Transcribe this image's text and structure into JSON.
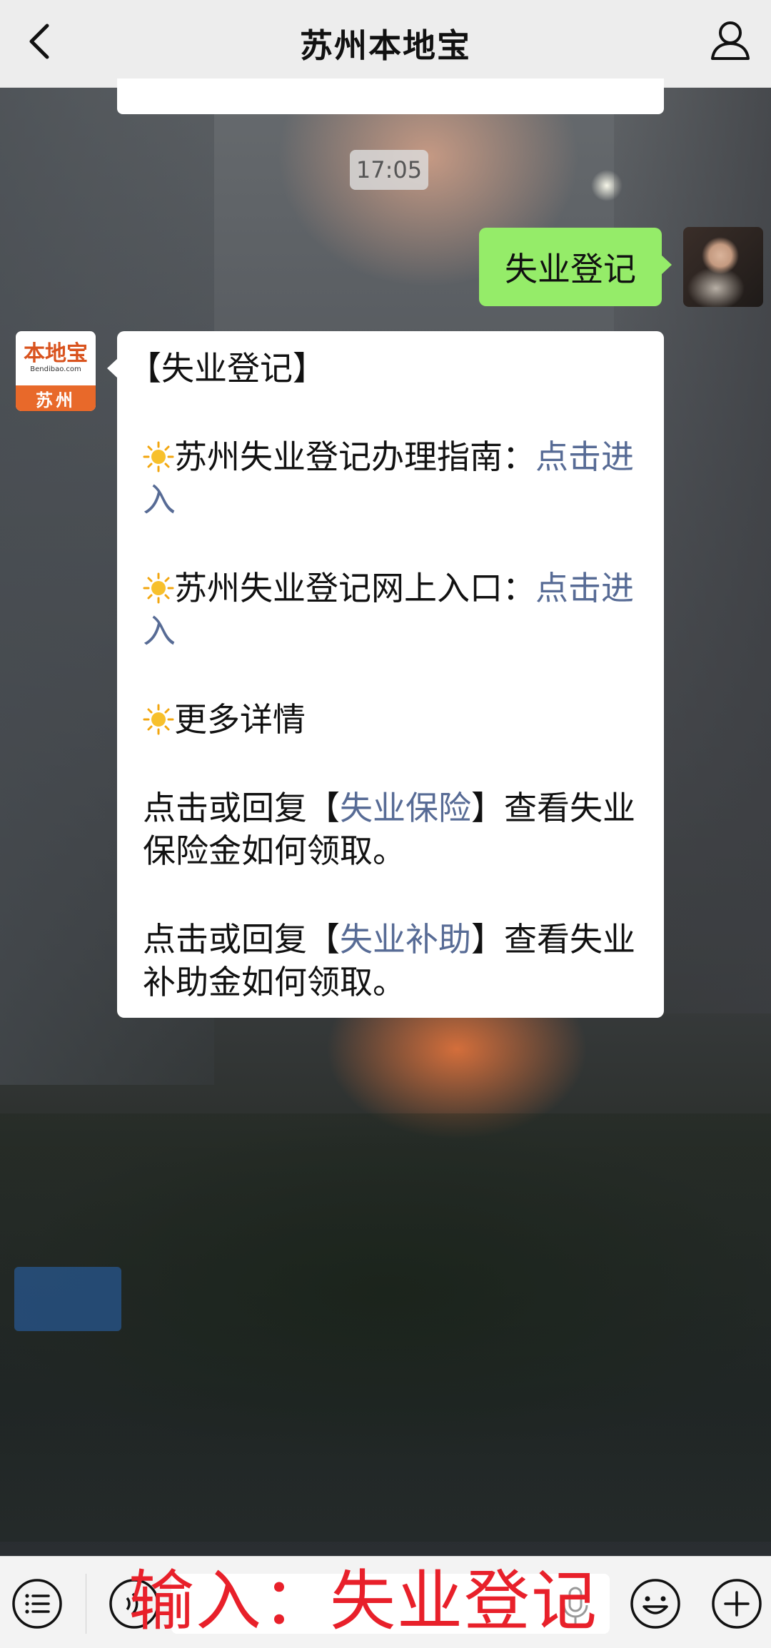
{
  "header": {
    "title": "苏州本地宝"
  },
  "chat": {
    "time_stamp": "17:05",
    "user_message": "失业登记",
    "bot_avatar": {
      "brand": "本地宝",
      "site": "Bendibao.com",
      "city": "苏州"
    },
    "bot_message": {
      "heading": "【失业登记】",
      "item1_text": "苏州失业登记办理指南：",
      "item1_link": "点击进入",
      "item2_text": "苏州失业登记网上入口：",
      "item2_link": "点击进入",
      "item3_text": "更多详情",
      "line4_prefix": "点击或回复【",
      "line4_link": "失业保险",
      "line4_suffix": "】查看失业保险金如何领取。",
      "line5_prefix": "点击或回复【",
      "line5_link": "失业补助",
      "line5_suffix": "】查看失业补助金如何领取。"
    }
  },
  "input_bar": {
    "overlay_text": "输入：失业登记"
  },
  "colors": {
    "link": "#576b95",
    "user_bubble": "#95ec69",
    "overlay_red": "#e8202a",
    "brand_orange": "#e8692a"
  }
}
